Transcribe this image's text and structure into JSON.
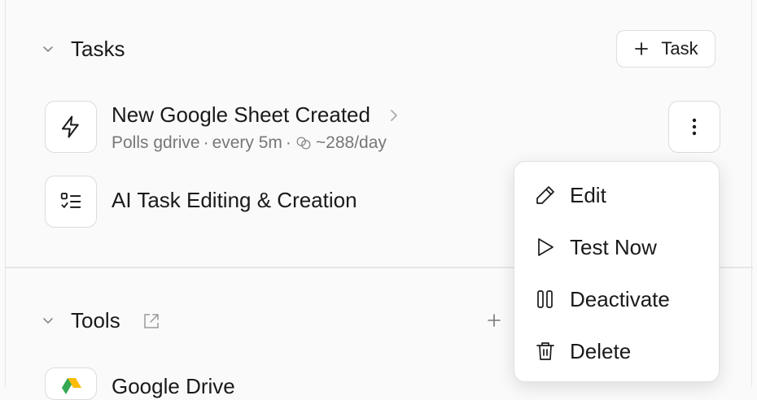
{
  "tasks_section": {
    "title": "Tasks",
    "add_button_label": "Task"
  },
  "tasks": [
    {
      "title": "New Google Sheet Created",
      "subtitle_source": "Polls gdrive",
      "subtitle_interval": "every 5m",
      "subtitle_rate": "~288/day",
      "icon": "lightning-icon"
    },
    {
      "title": "AI Task Editing & Creation",
      "icon": "checklist-icon"
    }
  ],
  "tools_section": {
    "title": "Tools"
  },
  "tools": [
    {
      "title": "Google Drive"
    }
  ],
  "context_menu": {
    "items": [
      {
        "label": "Edit",
        "icon": "pencil-icon"
      },
      {
        "label": "Test Now",
        "icon": "play-icon"
      },
      {
        "label": "Deactivate",
        "icon": "pause-icon"
      },
      {
        "label": "Delete",
        "icon": "trash-icon"
      }
    ]
  }
}
